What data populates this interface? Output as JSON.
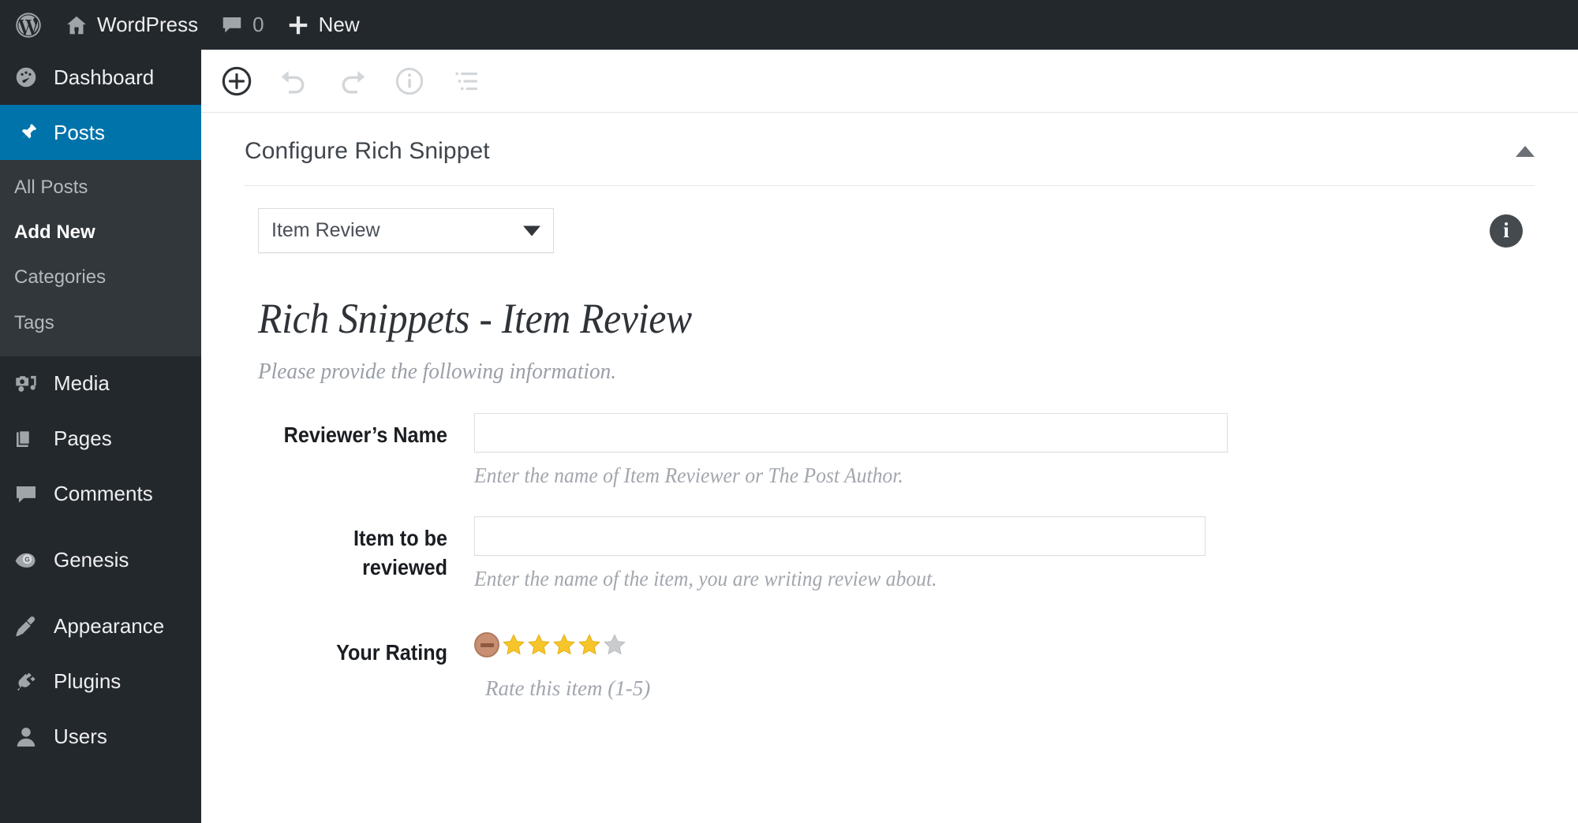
{
  "adminbar": {
    "logo_icon": "wordpress-logo-icon",
    "site_icon": "home-icon",
    "site_name": "WordPress",
    "comments_icon": "comment-bubble-icon",
    "comments_count": "0",
    "new_icon": "plus-icon",
    "new_label": "New"
  },
  "sidebar": {
    "items": [
      {
        "label": "Dashboard",
        "icon": "dashboard-gauge-icon",
        "current": false
      },
      {
        "label": "Posts",
        "icon": "pushpin-icon",
        "current": true
      },
      {
        "label": "Media",
        "icon": "media-camera-music-icon",
        "current": false
      },
      {
        "label": "Pages",
        "icon": "pages-stack-icon",
        "current": false
      },
      {
        "label": "Comments",
        "icon": "comment-bubble-icon",
        "current": false
      },
      {
        "label": "Genesis",
        "icon": "genesis-g-icon",
        "current": false
      },
      {
        "label": "Appearance",
        "icon": "paintbrush-icon",
        "current": false
      },
      {
        "label": "Plugins",
        "icon": "plug-icon",
        "current": false
      },
      {
        "label": "Users",
        "icon": "user-icon",
        "current": false
      }
    ],
    "posts_submenu": [
      {
        "label": "All Posts",
        "active": false
      },
      {
        "label": "Add New",
        "active": true
      },
      {
        "label": "Categories",
        "active": false
      },
      {
        "label": "Tags",
        "active": false
      }
    ],
    "accent_color": "#0073aa",
    "background_color": "#23282d",
    "submenu_background": "#32373c"
  },
  "toolbar": {
    "buttons": [
      {
        "icon": "add-block-plus-circle-icon",
        "enabled": true
      },
      {
        "icon": "undo-arrow-icon",
        "enabled": false
      },
      {
        "icon": "redo-arrow-icon",
        "enabled": false
      },
      {
        "icon": "info-circle-icon",
        "enabled": false
      },
      {
        "icon": "list-view-icon",
        "enabled": false
      }
    ]
  },
  "panel": {
    "title": "Configure Rich Snippet",
    "collapse_icon": "triangle-up-icon",
    "select": {
      "value": "Item Review",
      "caret_icon": "caret-down-icon",
      "options": [
        "Item Review"
      ]
    },
    "info_icon": "info-filled-icon",
    "info_letter": "i"
  },
  "form": {
    "title": "Rich Snippets - Item Review",
    "subtitle": "Please provide the following information.",
    "fields": [
      {
        "label": "Reviewer’s Name",
        "value": "",
        "placeholder": "",
        "helper": "Enter the name of Item Reviewer or The Post Author.",
        "type": "text"
      },
      {
        "label": "Item to be reviewed",
        "value": "",
        "placeholder": "",
        "helper": "Enter the name of the item, you are writing review about.",
        "type": "text"
      },
      {
        "label": "Your Rating",
        "helper": "Rate this item (1-5)",
        "type": "rating",
        "rating_value": 4,
        "rating_max": 5,
        "cancel_icon": "no-rating-icon",
        "star_filled_color": "#f5c518",
        "star_empty_color": "#c9cbcd"
      }
    ]
  }
}
